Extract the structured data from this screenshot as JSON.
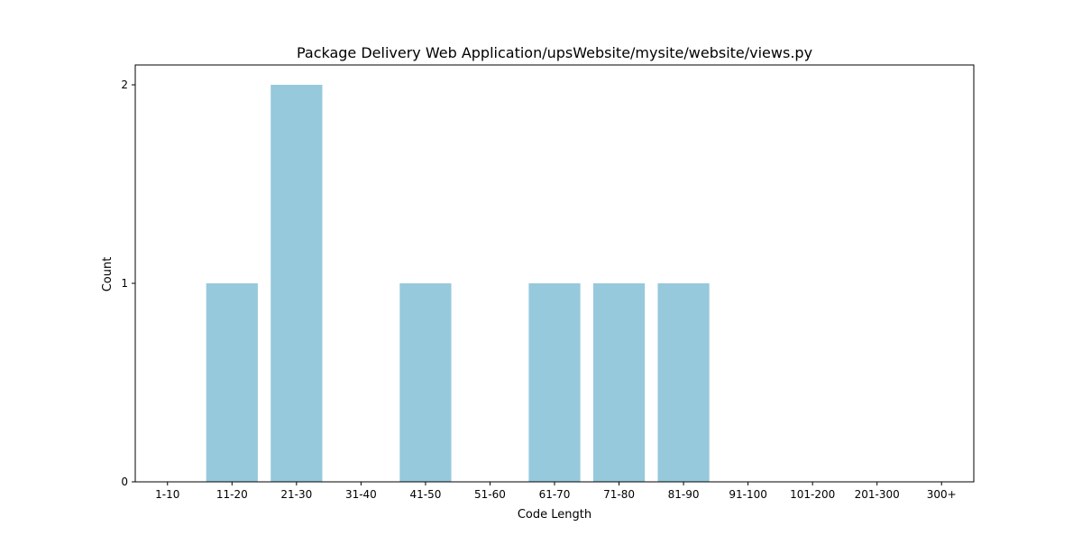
{
  "chart_data": {
    "type": "bar",
    "title": "Package Delivery Web Application/upsWebsite/mysite/website/views.py",
    "xlabel": "Code Length",
    "ylabel": "Count",
    "categories": [
      "1-10",
      "11-20",
      "21-30",
      "31-40",
      "41-50",
      "51-60",
      "61-70",
      "71-80",
      "81-90",
      "91-100",
      "101-200",
      "201-300",
      "300+"
    ],
    "values": [
      0,
      1,
      2,
      0,
      1,
      0,
      1,
      1,
      1,
      0,
      0,
      0,
      0
    ],
    "ylim": [
      0,
      2.1
    ],
    "yticks": [
      0,
      1,
      2
    ],
    "bar_color": "#96c9dc",
    "grid": false,
    "legend": "none"
  }
}
